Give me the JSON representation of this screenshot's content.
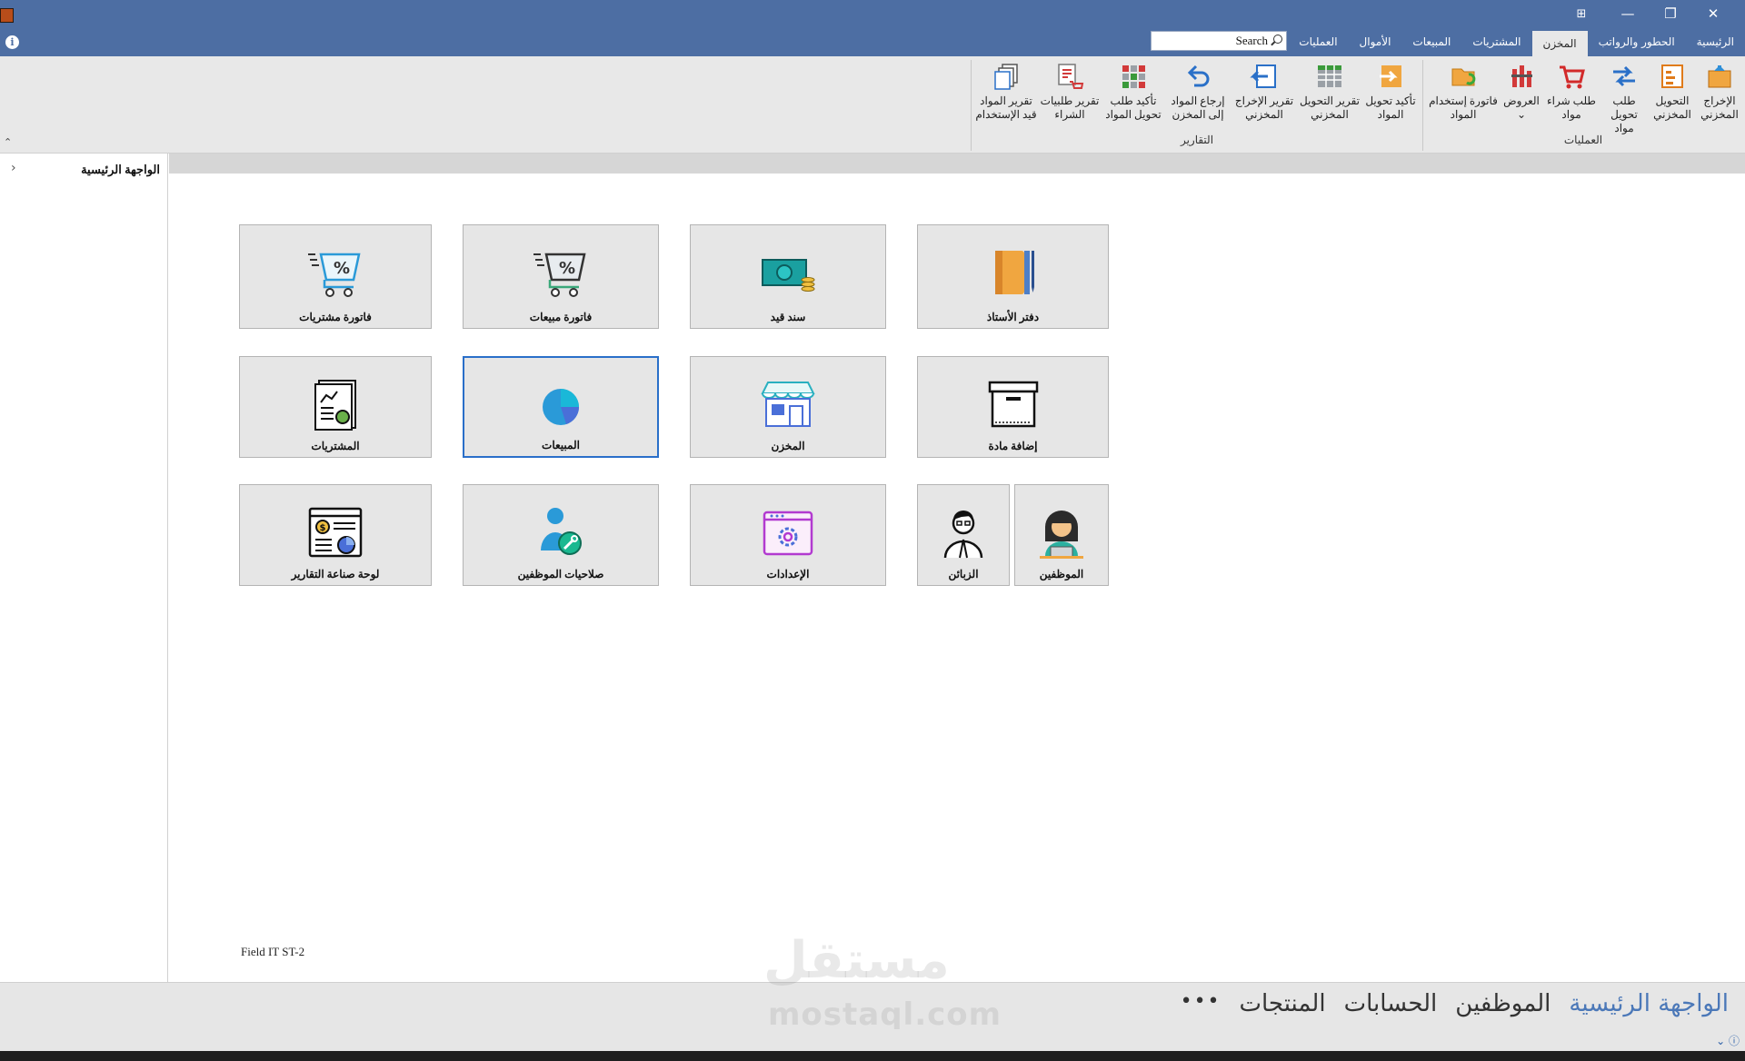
{
  "window": {
    "controls": {
      "close": "✕",
      "maximize": "❐",
      "minimize": "—",
      "options": "⊞"
    }
  },
  "ribbon_tabs": [
    "الرئيسية",
    "الحطور والرواتب",
    "المخزن",
    "المشتريات",
    "المبيعات",
    "الأموال",
    "العمليات"
  ],
  "active_tab": "المخزن",
  "search": {
    "placeholder": "Search"
  },
  "ribbon_groups": [
    {
      "label": "العمليات",
      "buttons": [
        {
          "label": "الإخراج المخزني",
          "icon": "box-out-icon"
        },
        {
          "label": "التحويل المخزني",
          "icon": "list-transfer-icon"
        },
        {
          "label": "طلب تحويل مواد",
          "icon": "transfer-arrows-icon"
        },
        {
          "label": "طلب شراء مواد",
          "icon": "cart-icon"
        },
        {
          "label": "العروض",
          "icon": "offers-icon",
          "dropdown": "⌄"
        },
        {
          "label": "فاتورة إستخدام المواد",
          "icon": "usage-invoice-icon"
        }
      ]
    },
    {
      "label": "التقارير",
      "buttons": [
        {
          "label": "تأكيد تحويل المواد",
          "icon": "confirm-transfer-icon"
        },
        {
          "label": "تقرير التحويل المخزني",
          "icon": "grid-report-icon"
        },
        {
          "label": "تقرير الإخراج المخزني",
          "icon": "exit-report-icon"
        },
        {
          "label": "إرجاع المواد إلى المخزن",
          "icon": "return-arrow-icon"
        },
        {
          "label": "تأكيد طلب تحويل المواد",
          "icon": "grid-color-icon"
        },
        {
          "label": "تقرير طلبيات الشراء",
          "icon": "purchase-report-icon"
        },
        {
          "label": "تقرير المواد قيد الإستخدام",
          "icon": "copy-report-icon"
        }
      ]
    }
  ],
  "leftnav": {
    "home": "الواجهة الرئيسية",
    "chevron": "›"
  },
  "tiles": [
    {
      "label": "دفتر الأستاذ",
      "icon": "ledger-book-icon"
    },
    {
      "label": "سند قيد",
      "icon": "cash-voucher-icon"
    },
    {
      "label": "فاتورة مبيعات",
      "icon": "sales-invoice-cart-icon"
    },
    {
      "label": "فاتورة مشتريات",
      "icon": "purchase-invoice-cart-icon"
    },
    {
      "label": "إضافة مادة",
      "icon": "add-item-box-icon"
    },
    {
      "label": "المخزن",
      "icon": "store-icon"
    },
    {
      "label": "المبيعات",
      "icon": "sales-pie-icon",
      "selected": true
    },
    {
      "label": "المشتريات",
      "icon": "purchases-report-icon"
    },
    {
      "label": "الموظفين",
      "icon": "employee-woman-icon"
    },
    {
      "label": "الزبائن",
      "icon": "customer-man-icon"
    },
    {
      "label": "الإعدادات",
      "icon": "settings-gear-icon"
    },
    {
      "label": "صلاحيات الموظفين",
      "icon": "user-key-icon"
    },
    {
      "label": "لوحة صناعة التقارير",
      "icon": "report-dashboard-icon"
    }
  ],
  "footer_note": "Field IT ST-2",
  "bottom_nav": {
    "items": [
      "الواجهة الرئيسية",
      "الموظفين",
      "الحسابات",
      "المنتجات"
    ],
    "active": "الواجهة الرئيسية",
    "more": "•••"
  },
  "watermark": {
    "arabic": "مستقل",
    "latin": "mostaql.com"
  },
  "colors": {
    "titlebar": "#4d6ea3",
    "ribbon": "#e8e8e8",
    "tile": "#e6e6e6",
    "selected_border": "#2a6fc9",
    "active_nav": "#4b78b8"
  }
}
